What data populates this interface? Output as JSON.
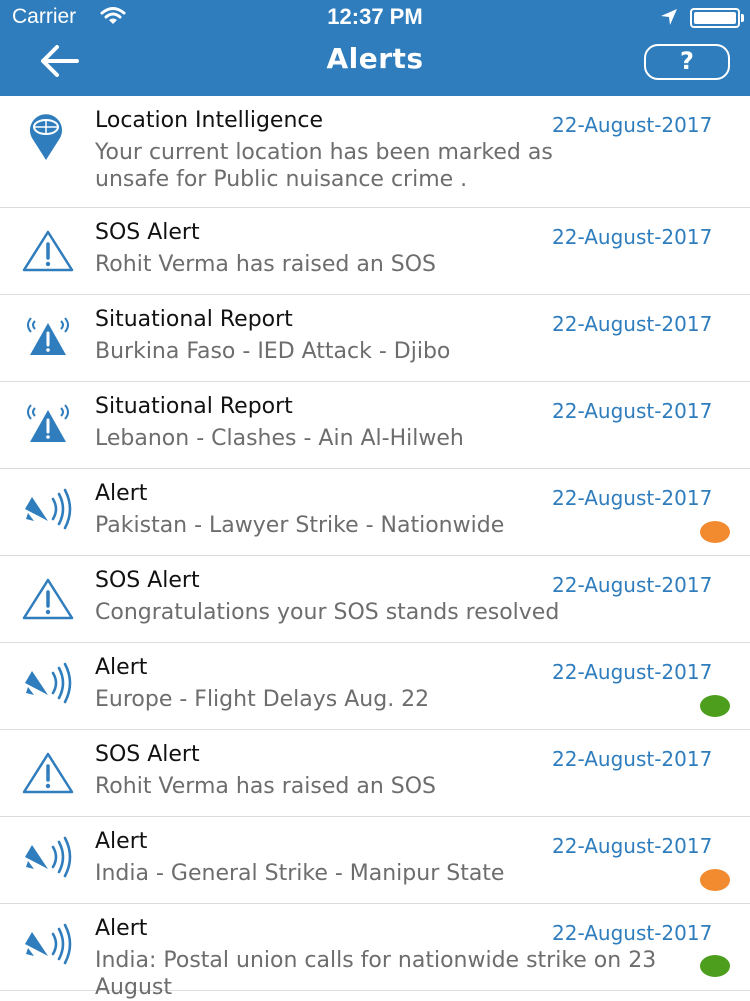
{
  "status_bar": {
    "carrier": "Carrier",
    "time": "12:37 PM"
  },
  "header": {
    "title": "Alerts",
    "help_label": "?",
    "color": "#2f7dbd"
  },
  "colors": {
    "accent": "#2f7dbd",
    "orange": "#f28b30",
    "green": "#4e9e1e"
  },
  "alerts": [
    {
      "icon": "location-pin-icon",
      "title": "Location Intelligence",
      "message": "Your current location has been marked as unsafe for Public nuisance crime .",
      "date": "22-August-2017",
      "status": null
    },
    {
      "icon": "warning-triangle-icon",
      "title": "SOS Alert",
      "message": "Rohit Verma has raised an SOS",
      "date": "22-August-2017",
      "status": null
    },
    {
      "icon": "broadcast-warning-icon",
      "title": "Situational Report",
      "message": "Burkina Faso - IED Attack - Djibo",
      "date": "22-August-2017",
      "status": null
    },
    {
      "icon": "broadcast-warning-icon",
      "title": "Situational Report",
      "message": "Lebanon - Clashes - Ain Al-Hilweh",
      "date": "22-August-2017",
      "status": null
    },
    {
      "icon": "bell-sound-icon",
      "title": "Alert",
      "message": "Pakistan - Lawyer Strike - Nationwide",
      "date": "22-August-2017",
      "status": "orange"
    },
    {
      "icon": "warning-triangle-icon",
      "title": "SOS Alert",
      "message": "Congratulations your SOS stands resolved",
      "date": "22-August-2017",
      "status": null
    },
    {
      "icon": "bell-sound-icon",
      "title": "Alert",
      "message": "Europe - Flight Delays Aug. 22",
      "date": "22-August-2017",
      "status": "green"
    },
    {
      "icon": "warning-triangle-icon",
      "title": "SOS Alert",
      "message": "Rohit Verma has raised an SOS",
      "date": "22-August-2017",
      "status": null
    },
    {
      "icon": "bell-sound-icon",
      "title": "Alert",
      "message": "India - General Strike - Manipur State",
      "date": "22-August-2017",
      "status": "orange"
    },
    {
      "icon": "bell-sound-icon",
      "title": "Alert",
      "message": "India: Postal union calls for nationwide strike on 23 August",
      "date": "22-August-2017",
      "status": "green"
    }
  ]
}
